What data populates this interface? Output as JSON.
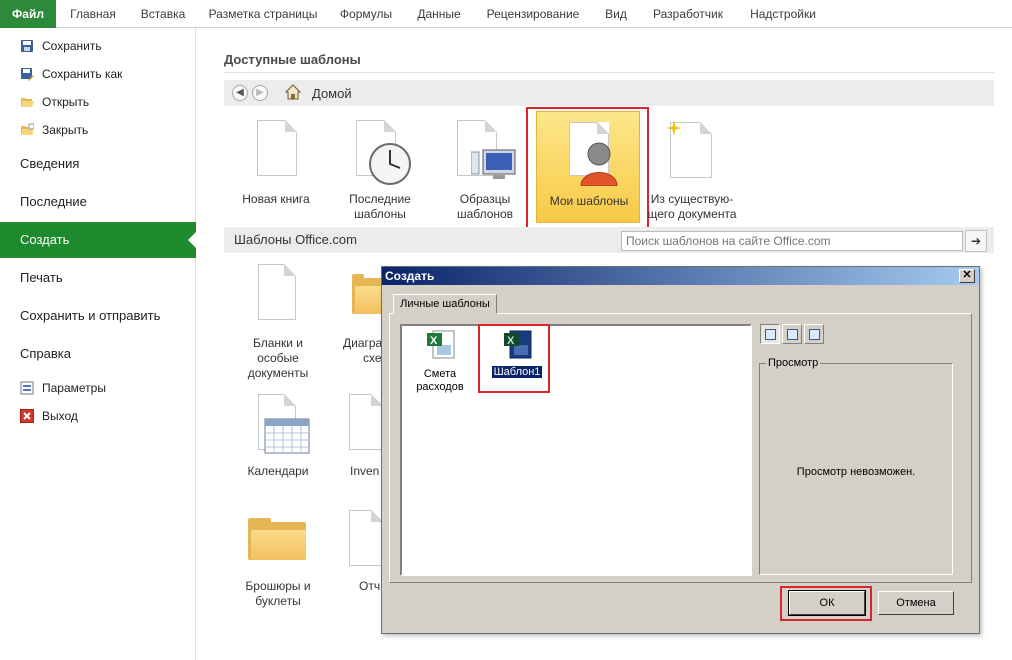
{
  "ribbon": {
    "tabs": [
      "Файл",
      "Главная",
      "Вставка",
      "Разметка страницы",
      "Формулы",
      "Данные",
      "Рецензирование",
      "Вид",
      "Разработчик",
      "Надстройки"
    ]
  },
  "nav": {
    "save": "Сохранить",
    "save_as": "Сохранить как",
    "open": "Открыть",
    "close": "Закрыть",
    "info": "Сведения",
    "recent": "Последние",
    "new": "Создать",
    "print": "Печать",
    "share": "Сохранить и отправить",
    "help": "Справка",
    "options": "Параметры",
    "exit": "Выход"
  },
  "main": {
    "title": "Доступные шаблоны",
    "home": "Домой",
    "tiles": {
      "blank_1": "Новая книга",
      "recent_1": "Последние",
      "recent_2": "шаблоны",
      "sample_1": "Образцы",
      "sample_2": "шаблонов",
      "my_1": "Мои шаблоны",
      "existing_1": "Из существую-",
      "existing_2": "щего документа"
    },
    "office_title": "Шаблоны Office.com",
    "search_placeholder": "Поиск шаблонов на сайте Office.com",
    "go_arrow": "➔",
    "office_tiles": {
      "forms_1": "Бланки и",
      "forms_2": "особые",
      "forms_3": "документы",
      "diagrams_1": "Диагра",
      "diagrams_2": "схе",
      "calendars": "Календари",
      "inventory": "Inven",
      "brochures_1": "Брошюры и",
      "brochures_2": "буклеты",
      "reports": "Отч"
    }
  },
  "dialog": {
    "title": "Создать",
    "close": "✕",
    "tab": "Личные шаблоны",
    "files": [
      {
        "line1": "Смета",
        "line2": "расходов"
      },
      {
        "line1": "Шаблон1"
      }
    ],
    "preview_label": "Просмотр",
    "preview_message": "Просмотр невозможен.",
    "ok": "ОК",
    "cancel": "Отмена"
  },
  "colors": {
    "file_tab": "#2d8a3a",
    "nav_active": "#1e8a2e",
    "highlight_box": "#d9262b",
    "dialog_title": "#0a246a"
  }
}
